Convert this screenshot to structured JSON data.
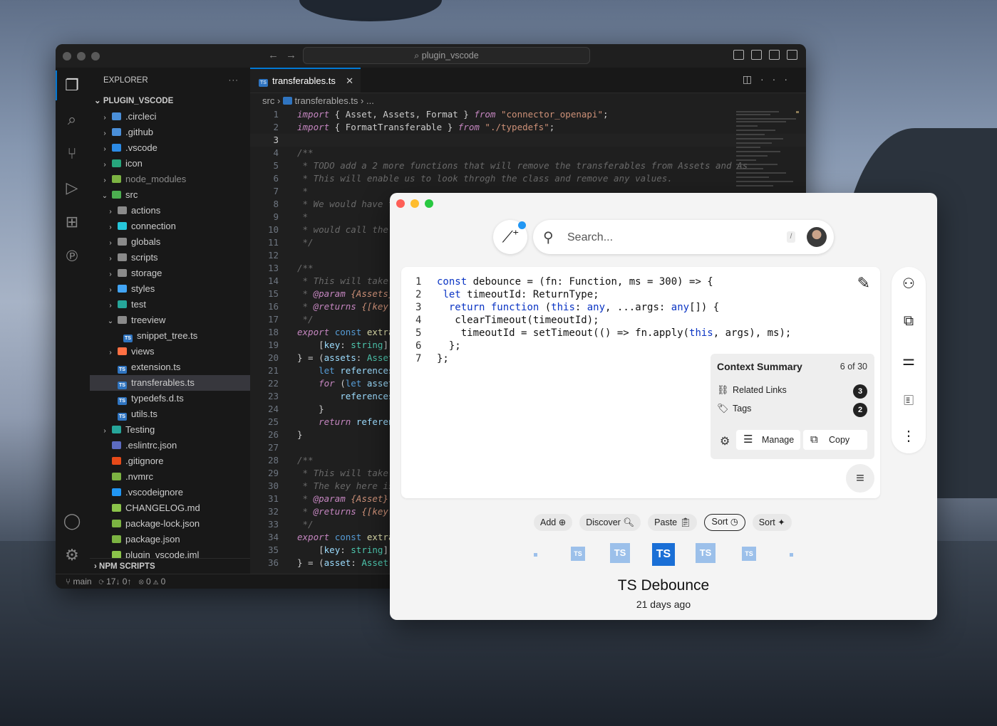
{
  "vscode": {
    "search_text": "plugin_vscode",
    "explorer_title": "EXPLORER",
    "project": "PLUGIN_VSCODE",
    "tree": [
      {
        "label": ".circleci",
        "indent": 1,
        "chev": "›",
        "icon_color": "#4a8fd9"
      },
      {
        "label": ".github",
        "indent": 1,
        "chev": "›",
        "icon_color": "#4a8fd9"
      },
      {
        "label": ".vscode",
        "indent": 1,
        "chev": "›",
        "icon_color": "#2c8be5"
      },
      {
        "label": "icon",
        "indent": 1,
        "chev": "›",
        "icon_color": "#27a67c"
      },
      {
        "label": "node_modules",
        "indent": 1,
        "chev": "›",
        "icon_color": "#7cb342",
        "muted": true
      },
      {
        "label": "src",
        "indent": 1,
        "chev": "⌄",
        "icon_color": "#4caf50"
      },
      {
        "label": "actions",
        "indent": 2,
        "chev": "›",
        "icon_color": "#8a8a8a"
      },
      {
        "label": "connection",
        "indent": 2,
        "chev": "›",
        "icon_color": "#26c6da"
      },
      {
        "label": "globals",
        "indent": 2,
        "chev": "›",
        "icon_color": "#8a8a8a"
      },
      {
        "label": "scripts",
        "indent": 2,
        "chev": "›",
        "icon_color": "#8a8a8a"
      },
      {
        "label": "storage",
        "indent": 2,
        "chev": "›",
        "icon_color": "#8a8a8a"
      },
      {
        "label": "styles",
        "indent": 2,
        "chev": "›",
        "icon_color": "#42a5f5"
      },
      {
        "label": "test",
        "indent": 2,
        "chev": "›",
        "icon_color": "#26a69a"
      },
      {
        "label": "treeview",
        "indent": 2,
        "chev": "⌄",
        "icon_color": "#8a8a8a"
      },
      {
        "label": "snippet_tree.ts",
        "indent": 3,
        "chev": "",
        "ts": true
      },
      {
        "label": "views",
        "indent": 2,
        "chev": "›",
        "icon_color": "#ff7043"
      },
      {
        "label": "extension.ts",
        "indent": 2,
        "chev": "",
        "ts": true
      },
      {
        "label": "transferables.ts",
        "indent": 2,
        "chev": "",
        "ts": true,
        "selected": true
      },
      {
        "label": "typedefs.d.ts",
        "indent": 2,
        "chev": "",
        "ts": true
      },
      {
        "label": "utils.ts",
        "indent": 2,
        "chev": "",
        "ts": true
      },
      {
        "label": "Testing",
        "indent": 1,
        "chev": "›",
        "icon_color": "#26a69a"
      },
      {
        "label": ".eslintrc.json",
        "indent": 1,
        "chev": "",
        "icon_color": "#5c6bc0"
      },
      {
        "label": ".gitignore",
        "indent": 1,
        "chev": "",
        "icon_color": "#e64a19"
      },
      {
        "label": ".nvmrc",
        "indent": 1,
        "chev": "",
        "icon_color": "#7cb342"
      },
      {
        "label": ".vscodeignore",
        "indent": 1,
        "chev": "",
        "icon_color": "#2196f3"
      },
      {
        "label": "CHANGELOG.md",
        "indent": 1,
        "chev": "",
        "icon_color": "#8bc34a"
      },
      {
        "label": "package-lock.json",
        "indent": 1,
        "chev": "",
        "icon_color": "#7cb342"
      },
      {
        "label": "package.json",
        "indent": 1,
        "chev": "",
        "icon_color": "#7cb342"
      },
      {
        "label": "plugin_vscode.iml",
        "indent": 1,
        "chev": "",
        "icon_color": "#8bc34a"
      }
    ],
    "npm_scripts": "NPM SCRIPTS",
    "tab_label": "transferables.ts",
    "breadcrumb": [
      "src",
      "transferables.ts",
      "..."
    ],
    "status": {
      "branch": "main",
      "sync": "17↓ 0↑",
      "problems": "⊗ 0 ⚠ 0"
    }
  },
  "pieces": {
    "search_placeholder": "Search...",
    "search_shortcut": "/",
    "code_lines": [
      "const debounce = (fn: Function, ms = 300) => {",
      " let timeoutId: ReturnType;",
      "  return function (this: any, ...args: any[]) {",
      "   clearTimeout(timeoutId);",
      "    timeoutId = setTimeout(() => fn.apply(this, args), ms);",
      "  };",
      "};"
    ],
    "context": {
      "title": "Context Summary",
      "count": "6 of 30",
      "related_links_label": "Related Links",
      "related_links_count": "3",
      "tags_label": "Tags",
      "tags_count": "2",
      "manage_label": "Manage",
      "copy_label": "Copy"
    },
    "chips": {
      "add": "Add ⊕",
      "discover": "Discover 🔍︎",
      "paste": "Paste 📋︎",
      "sort_recent": "Sort ◷",
      "sort_ai": "Sort ✦"
    },
    "snippet_title": "TS Debounce",
    "snippet_date": "21 days ago"
  }
}
